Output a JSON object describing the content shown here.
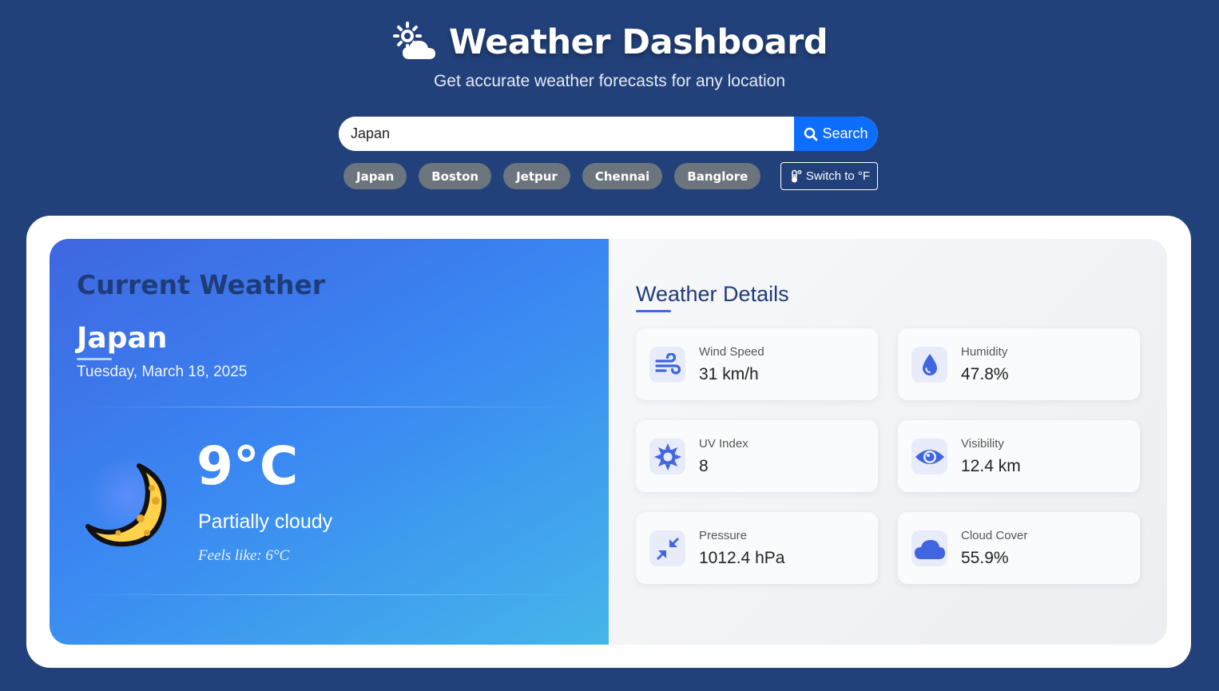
{
  "header": {
    "title": "Weather Dashboard",
    "subtitle": "Get accurate weather forecasts for any location",
    "icon": "sun-cloud-icon"
  },
  "search": {
    "value": "Japan",
    "button_label": "Search"
  },
  "quick_cities": [
    "Japan",
    "Boston",
    "Jetpur",
    "Chennai",
    "Banglore"
  ],
  "unit_toggle": {
    "label": "Switch to °F"
  },
  "current": {
    "heading": "Current Weather",
    "city": "Japan",
    "date": "Tuesday, March 18, 2025",
    "temperature": "9°C",
    "condition": "Partially cloudy",
    "feels_like": "Feels like: 6°C",
    "icon": "crescent-moon-icon"
  },
  "details": {
    "heading": "Weather Details",
    "items": [
      {
        "label": "Wind Speed",
        "value": "31 km/h",
        "icon": "wind-icon"
      },
      {
        "label": "Humidity",
        "value": "47.8%",
        "icon": "droplet-icon"
      },
      {
        "label": "UV Index",
        "value": "8",
        "icon": "sun-icon"
      },
      {
        "label": "Visibility",
        "value": "12.4 km",
        "icon": "eye-icon"
      },
      {
        "label": "Pressure",
        "value": "1012.4 hPa",
        "icon": "compress-icon"
      },
      {
        "label": "Cloud Cover",
        "value": "55.9%",
        "icon": "cloud-icon"
      }
    ]
  },
  "colors": {
    "background": "#22417a",
    "accent": "#0d6efd",
    "heading": "#1f3c7a",
    "icon": "#3f66e0",
    "chip": "#6c757d"
  }
}
